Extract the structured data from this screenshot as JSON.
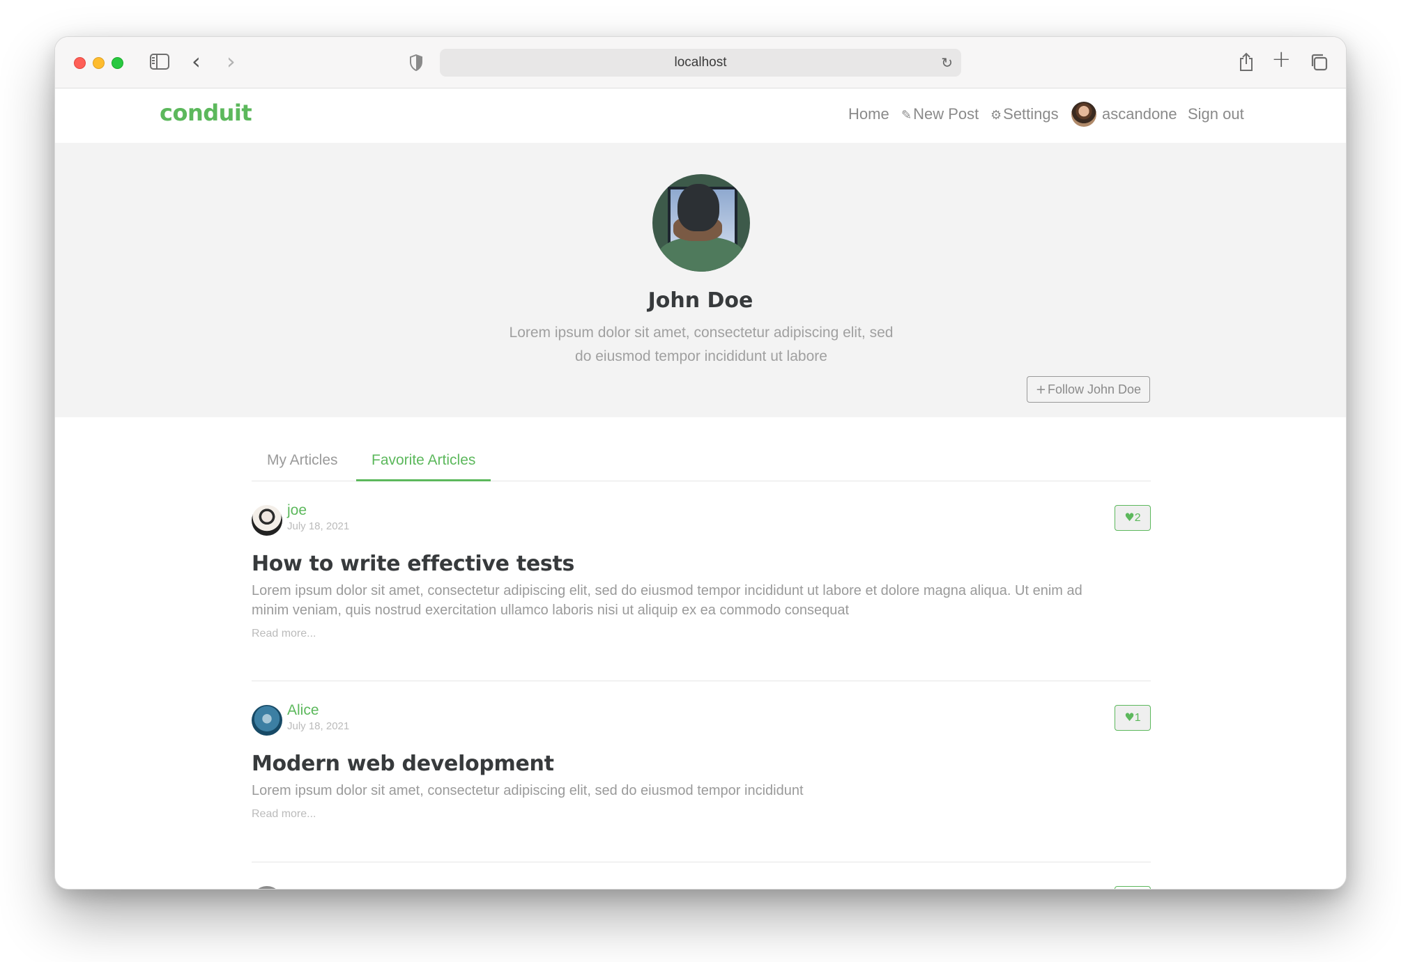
{
  "browser": {
    "url": "localhost"
  },
  "navbar": {
    "brand": "conduit",
    "home": "Home",
    "new_post": "New Post",
    "settings": "Settings",
    "username": "ascandone",
    "sign_out": "Sign out"
  },
  "profile": {
    "name": "John Doe",
    "bio": "Lorem ipsum dolor sit amet, consectetur adipiscing elit, sed do eiusmod tempor incididunt ut labore",
    "follow_label": "Follow John Doe"
  },
  "tabs": {
    "my_articles": "My Articles",
    "favorite_articles": "Favorite Articles",
    "active": "Favorite Articles"
  },
  "articles": [
    {
      "author": "joe",
      "date": "July 18, 2021",
      "likes": "2",
      "title": "How to write effective tests",
      "description": "Lorem ipsum dolor sit amet, consectetur adipiscing elit, sed do eiusmod tempor incididunt ut labore et dolore magna aliqua. Ut enim ad minim veniam, quis nostrud exercitation ullamco laboris nisi ut aliquip ex ea commodo consequat",
      "read_more": "Read more..."
    },
    {
      "author": "Alice",
      "date": "July 18, 2021",
      "likes": "1",
      "title": "Modern web development",
      "description": "Lorem ipsum dolor sit amet, consectetur adipiscing elit, sed do eiusmod tempor incididunt",
      "read_more": "Read more..."
    }
  ],
  "colors": {
    "brand": "#5cb85c",
    "banner_bg": "#f3f3f3",
    "title_text": "#373a3c"
  },
  "icons": {
    "new_post": "edit-icon",
    "settings": "gear-icon",
    "follow": "plus-icon",
    "like": "heart-icon"
  }
}
